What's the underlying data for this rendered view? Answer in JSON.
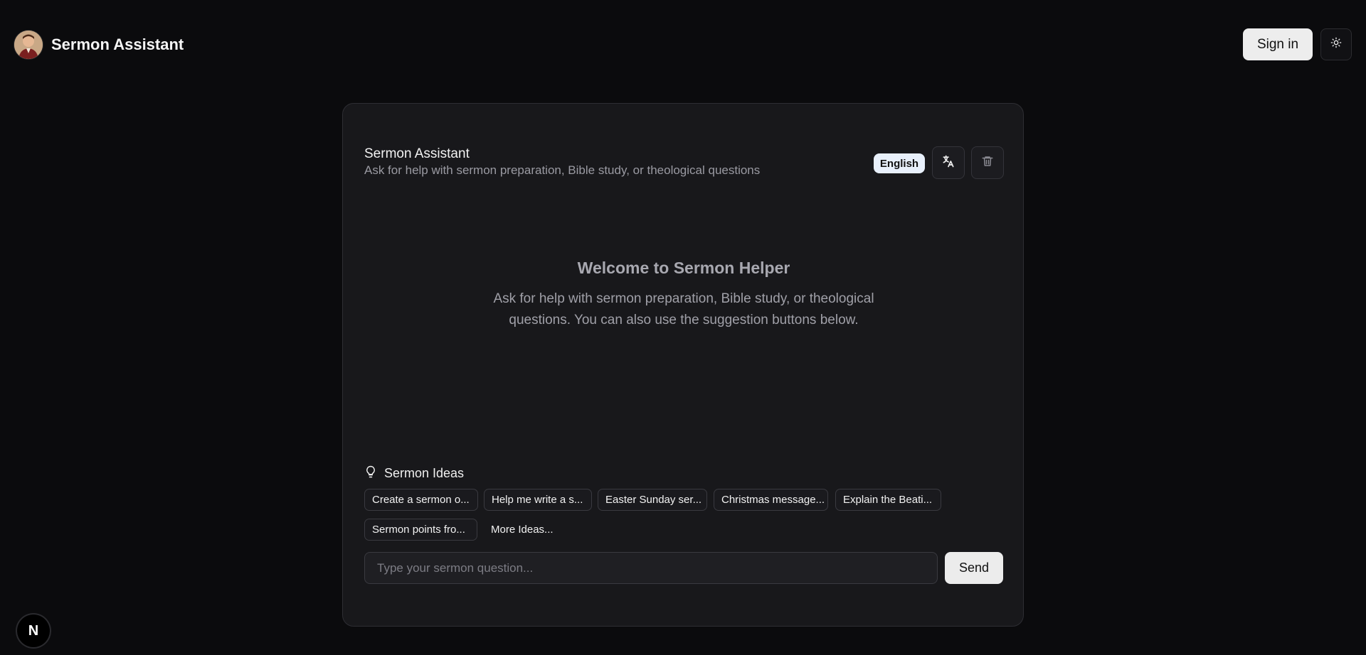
{
  "header": {
    "app_title": "Sermon Assistant",
    "signin_label": "Sign in"
  },
  "card": {
    "title": "Sermon Assistant",
    "subtitle": "Ask for help with sermon preparation, Bible study, or theological questions",
    "language_badge": "English"
  },
  "welcome": {
    "title": "Welcome to Sermon Helper",
    "text": "Ask for help with sermon preparation, Bible study, or theological questions. You can also use the suggestion buttons below."
  },
  "ideas": {
    "title": "Sermon Ideas",
    "chips": [
      "Create a sermon o...",
      "Help me write a s...",
      "Easter Sunday ser...",
      "Christmas message...",
      "Explain the Beati...",
      "Sermon points fro..."
    ],
    "more_label": "More Ideas..."
  },
  "composer": {
    "placeholder": "Type your sermon question...",
    "send_label": "Send"
  },
  "footer": {
    "badge_letter": "N"
  },
  "icons": {
    "theme": "sun-icon",
    "translate": "translate-icon",
    "delete": "trash-icon",
    "ideas": "lightbulb-icon"
  }
}
